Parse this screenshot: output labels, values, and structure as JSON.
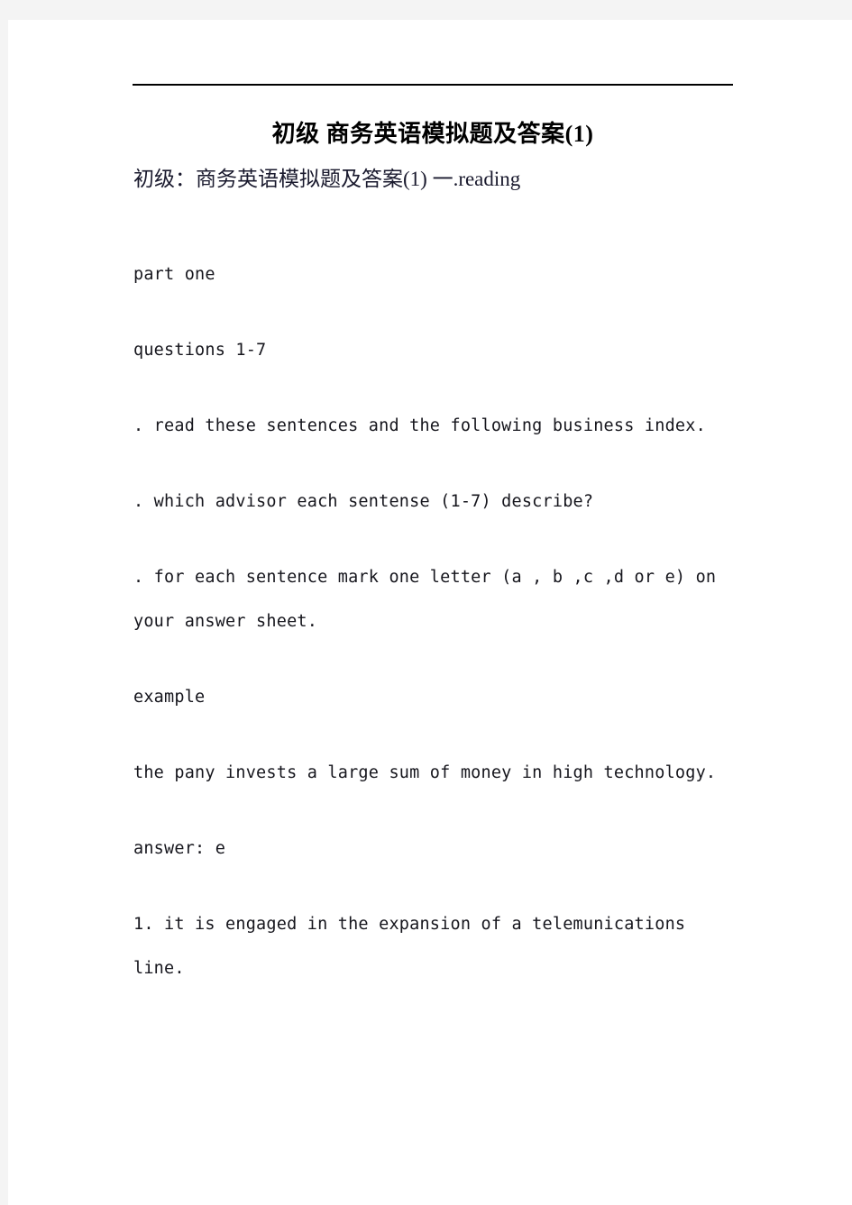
{
  "document": {
    "title": "初级 商务英语模拟题及答案(1)",
    "subtitle": "初级：商务英语模拟题及答案(1) 一.reading",
    "rule": {
      "visible": true,
      "color": "#000000"
    },
    "paragraphs": [
      {
        "id": "part-one",
        "text": "part one"
      },
      {
        "id": "questions-range",
        "text": "questions 1-7"
      },
      {
        "id": "instruction-read",
        "text": ". read these sentences and the following business index."
      },
      {
        "id": "instruction-which-advisor",
        "text": ". which advisor each sentense (1-7) describe?"
      },
      {
        "id": "instruction-mark-letter",
        "text": ". for each sentence mark one letter (a , b ,c ,d or e) on your answer sheet."
      },
      {
        "id": "example-label",
        "text": "example"
      },
      {
        "id": "example-sentence",
        "text": "the pany invests a large sum of money in high technology."
      },
      {
        "id": "example-answer",
        "text": "answer: e"
      },
      {
        "id": "question-1",
        "text": "1. it is engaged in the expansion of a telemunications line."
      }
    ]
  },
  "theme": {
    "page_background": "#ffffff",
    "canvas_background": "#f4f4f4",
    "text_color": "#16161d",
    "heading_color": "#000000"
  }
}
